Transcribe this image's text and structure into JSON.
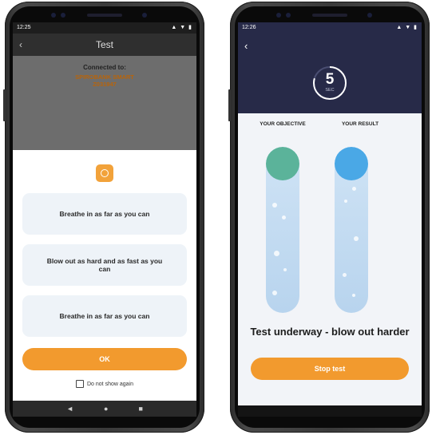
{
  "left_phone": {
    "status": {
      "time": "12:25",
      "icons": "▲ ▼ ▮"
    },
    "appbar": {
      "back_glyph": "‹",
      "title": "Test"
    },
    "connection": {
      "label": "Connected to:",
      "device_line1": "SPIROBANK SMART",
      "device_line2": "Z031947"
    },
    "dialog": {
      "icon": "warning-icon",
      "steps": [
        "Breathe in as far as you can",
        "Blow out as hard and as fast as you can",
        "Breathe in as far as you can"
      ],
      "ok_label": "OK",
      "checkbox_label": "Do not show again"
    },
    "nav": {
      "back": "◄",
      "home": "●",
      "recent": "■"
    }
  },
  "right_phone": {
    "status": {
      "time": "12:26",
      "icons": "▲ ▼ ▮"
    },
    "back_glyph": "‹",
    "timer": {
      "value": "5",
      "unit": "SEC"
    },
    "objective_label": "YOUR OBJECTIVE",
    "result_label": "YOUR RESULT",
    "objective_color": "#5bb39a",
    "result_color": "#4aa8e6",
    "status_message": "Test underway - blow out harder",
    "stop_label": "Stop test"
  },
  "colors": {
    "accent": "#f29a2e",
    "header_dark": "#272a48"
  }
}
